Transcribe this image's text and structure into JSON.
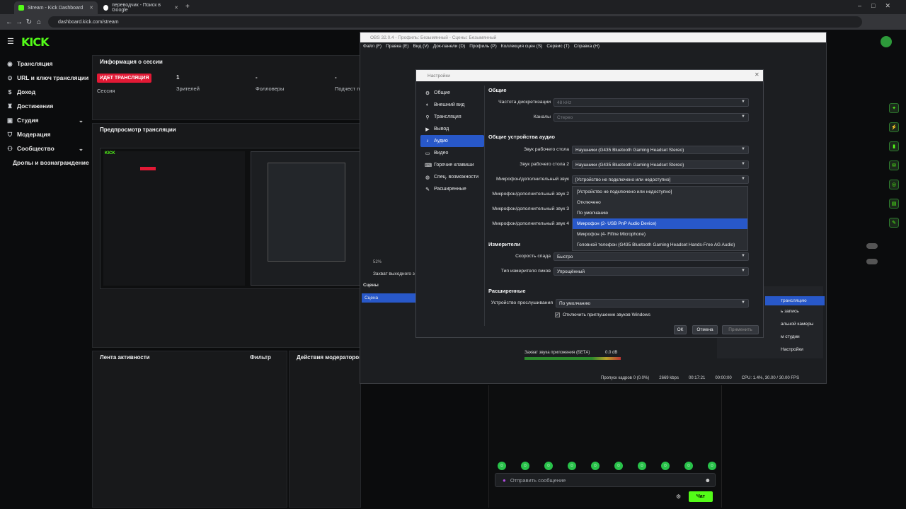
{
  "browser": {
    "tabs": [
      {
        "label": "Stream - Kick Dashboard",
        "active": true
      },
      {
        "label": "переводчик - Поиск в Google",
        "active": false
      }
    ],
    "url": "dashboard.kick.com/stream"
  },
  "kick": {
    "logo": "KICK",
    "sidebar": [
      {
        "label": "Трансляция",
        "icon": "broadcast-icon"
      },
      {
        "label": "URL и ключ трансляции",
        "icon": "key-icon"
      },
      {
        "label": "Доход",
        "icon": "dollar-icon"
      },
      {
        "label": "Достижения",
        "icon": "trophy-icon"
      },
      {
        "label": "Студия",
        "icon": "studio-icon"
      },
      {
        "label": "Модерация",
        "icon": "shield-icon"
      },
      {
        "label": "Сообщество",
        "icon": "people-icon"
      },
      {
        "label": "Дропы и вознаграждение",
        "icon": ""
      }
    ],
    "session": {
      "title": "Информация о сессии",
      "badge": "ИДЕТ ТРАНСЛЯЦИЯ",
      "badge_sub": "Сессия",
      "stats": [
        {
          "value": "1",
          "label": "Зрителей"
        },
        {
          "value": "-",
          "label": "Фолловеры"
        },
        {
          "value": "-",
          "label": "Подчест п"
        }
      ]
    },
    "preview_title": "Предпросмотр трансляции",
    "activity_title": "Лента активности",
    "filter_label": "Фильтр",
    "mod_title": "Действия модераторов",
    "chat_placeholder": "Отправить сообщение",
    "chat_button": "Чат"
  },
  "obs": {
    "title": "OBS 32.0.4 - Профиль: Безымянный - Сцены: Безымянный",
    "menu": [
      "Файл (F)",
      "Правка (E)",
      "Вид (V)",
      "Док-панели (D)",
      "Профиль (P)",
      "Коллекция сцен (S)",
      "Сервис (T)",
      "Справка (H)"
    ],
    "scenes_title": "Сцены",
    "scene_item": "Сцена",
    "audio_row": "Захват выходного з",
    "audio_row2": "Захват звука приложения (БЕТА)",
    "audio_db": "0.0 dB",
    "zoom": "52%",
    "right_items": [
      "трансляцию",
      "ь запись",
      "альной камеры",
      "м студии",
      "Настройки"
    ],
    "statusbar": {
      "drop": "Пропуск кадров 0 (0.0%)",
      "kbps": "2669 kbps",
      "time1": "00:17:21",
      "time2": "00:00:00",
      "cpu": "CPU: 1.4%, 30.00 / 30.00 FPS"
    }
  },
  "settings": {
    "title": "Настройки",
    "nav": [
      {
        "label": "Общие",
        "icon": "gear-icon"
      },
      {
        "label": "Внешний вид",
        "icon": "palette-icon"
      },
      {
        "label": "Трансляция",
        "icon": "antenna-icon"
      },
      {
        "label": "Вывод",
        "icon": "output-icon"
      },
      {
        "label": "Аудио",
        "icon": "speaker-icon"
      },
      {
        "label": "Видео",
        "icon": "monitor-icon"
      },
      {
        "label": "Горячие клавиши",
        "icon": "keyboard-icon"
      },
      {
        "label": "Спец. возможности",
        "icon": "accessibility-icon"
      },
      {
        "label": "Расширенные",
        "icon": "wrench-icon"
      }
    ],
    "general_title": "Общие",
    "sample_rate_label": "Частота дискретизации",
    "sample_rate": "48 kHz",
    "channels_label": "Каналы",
    "channels": "Стерео",
    "global_title": "Общие устройства аудио",
    "desktop1_label": "Звук рабочего стола",
    "desktop1": "Наушники (G435 Bluetooth Gaming Headset Stereo)",
    "desktop2_label": "Звук рабочего стола 2",
    "desktop2": "Наушники (G435 Bluetooth Gaming Headset Stereo)",
    "mic1_label": "Микрофон/дополнительный звук",
    "mic1": "[Устройство не подключено или недоступно]",
    "mic2_label": "Микрофон/дополнительный звук 2",
    "mic3_label": "Микрофон/дополнительный звук 3",
    "mic4_label": "Микрофон/дополнительный звук 4",
    "dropdown": [
      "[Устройство не подключено или недоступно]",
      "Отключено",
      "По умолчанию",
      "Микрофон (2- USB PnP Audio Device)",
      "Микрофон (4- Fifine Microphone)",
      "Головной телефон (G435 Bluetooth Gaming Headset Hands-Free AG Audio)"
    ],
    "meters_title": "Измерители",
    "decay_label": "Скорость спада",
    "decay": "Быстро",
    "peak_label": "Тип измерителя пиков",
    "peak": "Упрощённый",
    "advanced_title": "Расширенные",
    "monitor_label": "Устройство прослушивания",
    "monitor": "По умолчанию",
    "ducking": "Отключить приглушение звуков Windows",
    "ok": "ОК",
    "cancel": "Отмена",
    "apply": "Применить"
  },
  "colors": {
    "kick_green": "#53fc18",
    "obs_accent": "#2858c9",
    "live_red": "#e21935"
  }
}
